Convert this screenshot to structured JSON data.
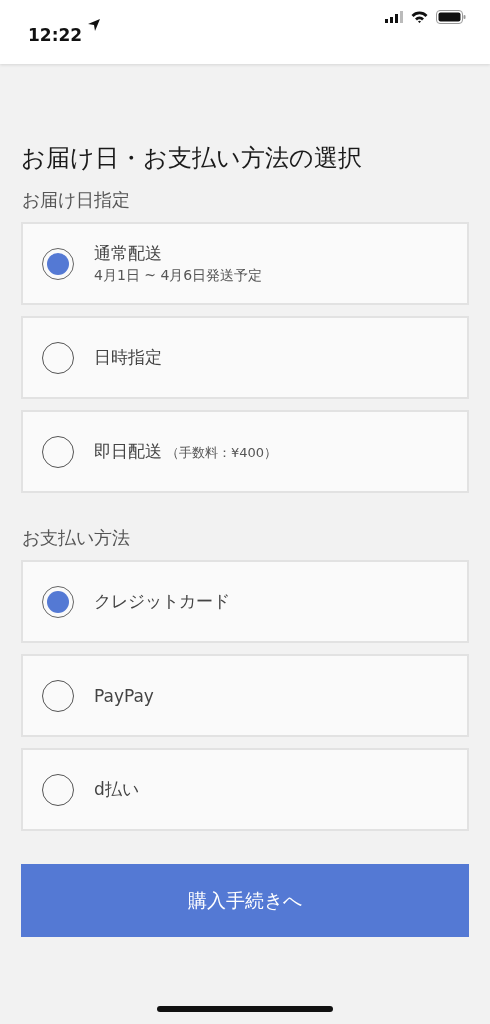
{
  "status_bar": {
    "time": "12:22"
  },
  "title": "お届け日・お支払い方法の選択",
  "sections": [
    {
      "label": "お届け日指定",
      "options": [
        {
          "label": "通常配送",
          "sub": "4月1日 ~ 4月6日発送予定",
          "selected": true
        },
        {
          "label": "日時指定",
          "selected": false
        },
        {
          "label": "即日配送",
          "note": "（手数料：¥400）",
          "selected": false
        }
      ]
    },
    {
      "label": "お支払い方法",
      "options": [
        {
          "label": "クレジットカード",
          "selected": true
        },
        {
          "label": "PayPay",
          "selected": false
        },
        {
          "label": "d払い",
          "selected": false
        }
      ]
    }
  ],
  "submit": "購入手続きへ"
}
